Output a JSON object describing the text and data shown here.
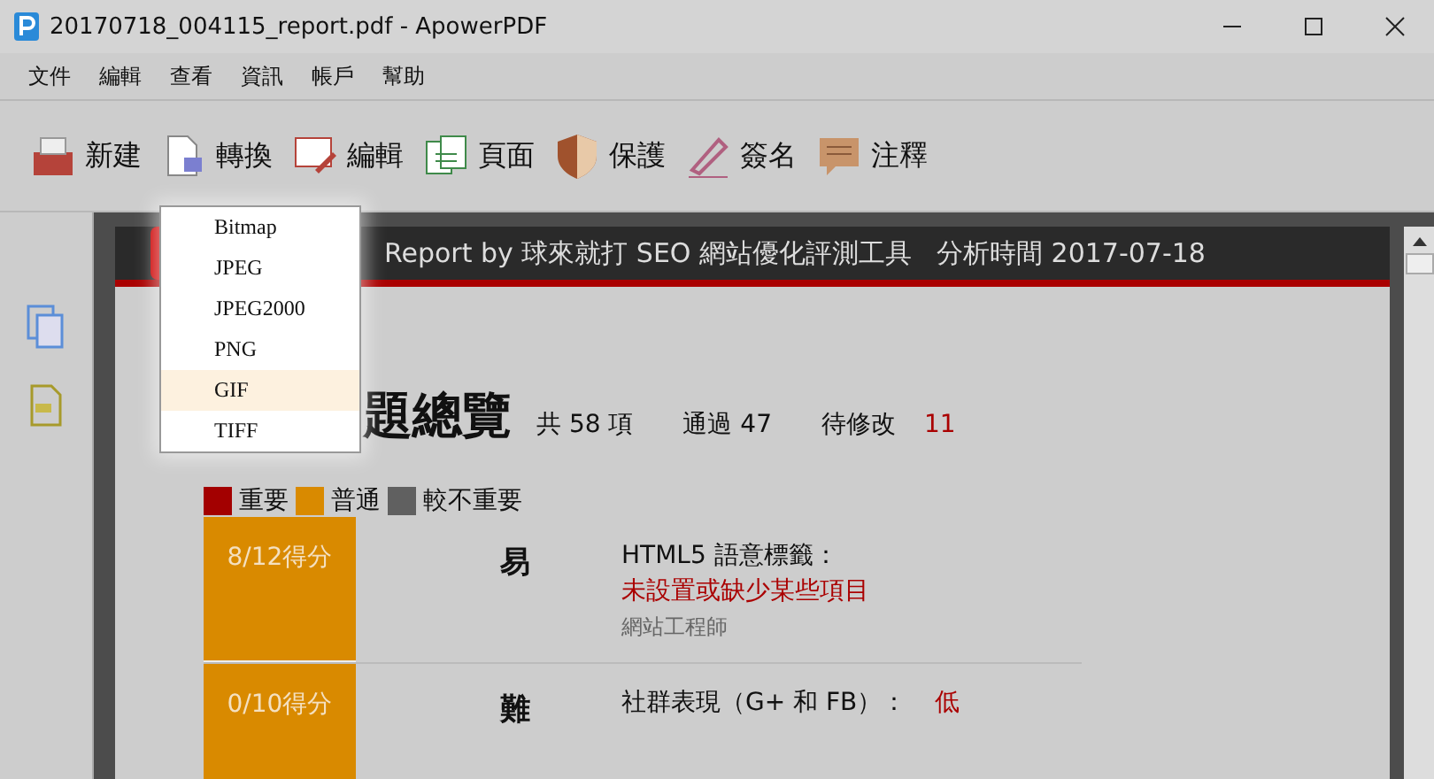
{
  "window": {
    "title": "20170718_004115_report.pdf - ApowerPDF"
  },
  "menu": [
    "文件",
    "編輯",
    "查看",
    "資訊",
    "帳戶",
    "幫助"
  ],
  "toolbar": [
    {
      "kind": "new",
      "label": "新建"
    },
    {
      "kind": "convert",
      "label": "轉換"
    },
    {
      "kind": "edit",
      "label": "編輯"
    },
    {
      "kind": "page",
      "label": "頁面"
    },
    {
      "kind": "protect",
      "label": "保護"
    },
    {
      "kind": "sign",
      "label": "簽名"
    },
    {
      "kind": "comment",
      "label": "注釋"
    }
  ],
  "dropdown": [
    {
      "label": "Bitmap",
      "selected": false
    },
    {
      "label": "JPEG",
      "selected": false
    },
    {
      "label": "JPEG2000",
      "selected": false
    },
    {
      "label": "PNG",
      "selected": false
    },
    {
      "label": "GIF",
      "selected": true
    },
    {
      "label": "TIFF",
      "selected": false
    }
  ],
  "report": {
    "header": "Report by 球來就打 SEO 網站優化評測工具",
    "date": "分析時間 2017-07-18",
    "heading": "題總覽",
    "total": "共 58 項",
    "passed": "通過 47",
    "pending_label": "待修改",
    "pending": "11",
    "legend": [
      {
        "label": "重要",
        "color": "#a30000"
      },
      {
        "label": "普通",
        "color": "#d98a00"
      },
      {
        "label": "較不重要",
        "color": "#606060"
      }
    ],
    "rows": [
      {
        "score": "8/12得分",
        "difficulty": "易",
        "title": "HTML5 語意標籤：",
        "issue": "未設置或缺少某些項目",
        "role": "網站工程師"
      },
      {
        "score": "0/10得分",
        "difficulty": "難",
        "title": "社群表現（G+ 和 FB）：",
        "issue": "低"
      }
    ]
  }
}
